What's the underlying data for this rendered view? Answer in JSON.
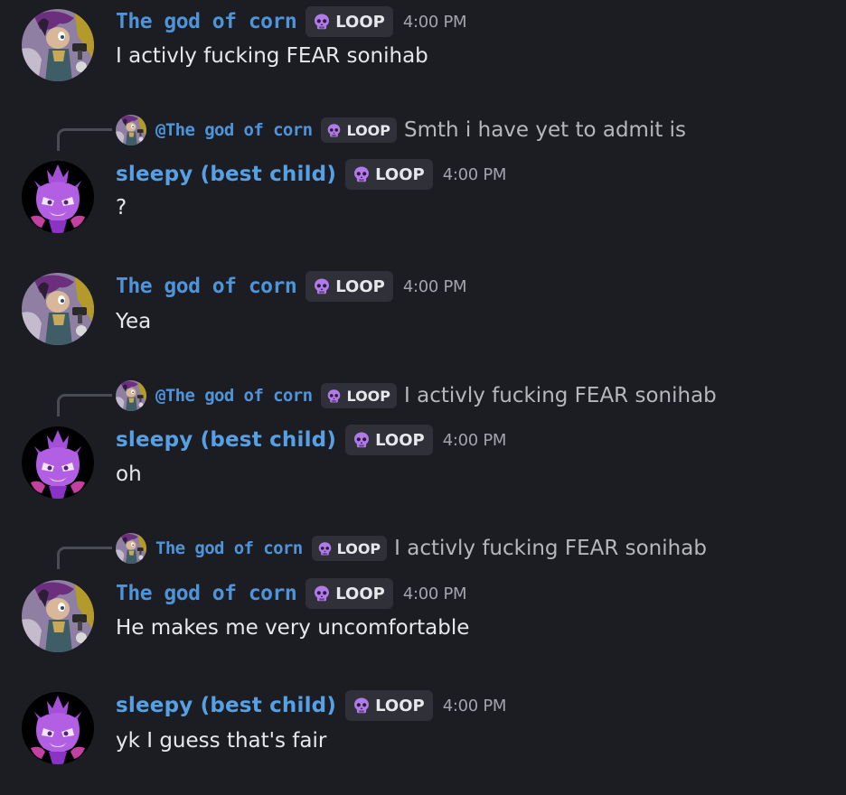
{
  "colors": {
    "background": "#1c1d22",
    "corn_name": "#4f93d9",
    "sleepy_name": "#56a0e3",
    "tag_bg": "#2f3038",
    "skull": "#b17ae8"
  },
  "tag_icon": "skull-icon",
  "messages": [
    {
      "author": "The god of corn",
      "tag": "LOOP",
      "time": "4:00 PM",
      "text": "I activly fucking FEAR sonihab"
    },
    {
      "reply": {
        "name": "@The god of corn",
        "tag": "LOOP",
        "text": "Smth i have yet to admit is"
      },
      "author": "sleepy (best child)",
      "tag": "LOOP",
      "time": "4:00 PM",
      "text": "?"
    },
    {
      "author": "The god of corn",
      "tag": "LOOP",
      "time": "4:00 PM",
      "text": "Yea"
    },
    {
      "reply": {
        "name": "@The god of corn",
        "tag": "LOOP",
        "text": "I activly fucking FEAR sonihab"
      },
      "author": "sleepy (best child)",
      "tag": "LOOP",
      "time": "4:00 PM",
      "text": "oh"
    },
    {
      "reply": {
        "name": "The god of corn",
        "tag": "LOOP",
        "text": "I activly fucking FEAR sonihab"
      },
      "author": "The god of corn",
      "tag": "LOOP",
      "time": "4:00 PM",
      "text": "He makes me very uncomfortable"
    },
    {
      "author": "sleepy (best child)",
      "tag": "LOOP",
      "time": "4:00 PM",
      "text": "yk I guess that's fair"
    }
  ]
}
